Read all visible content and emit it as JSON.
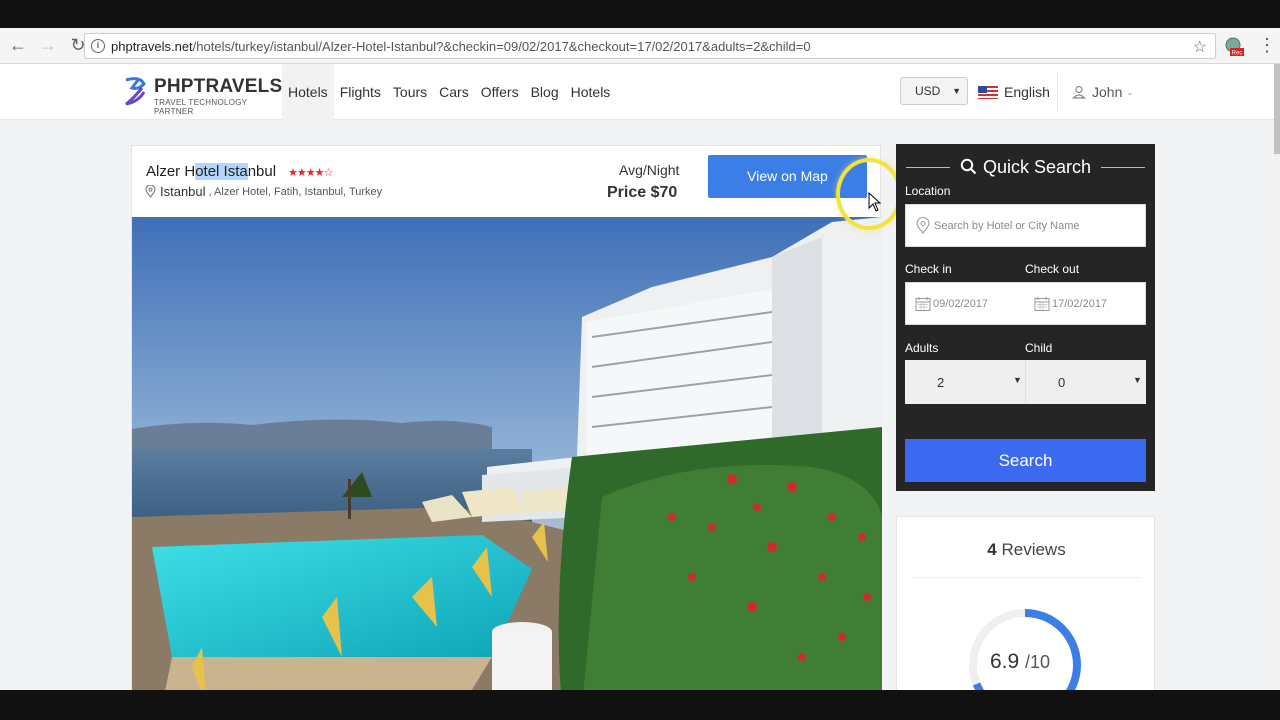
{
  "browser": {
    "url_domain": "phptravels.net",
    "url_path": "/hotels/turkey/istanbul/Alzer-Hotel-Istanbul?&checkin=09/02/2017&checkout=17/02/2017&adults=2&child=0"
  },
  "header": {
    "logo_brand": "PHPTRAVELS",
    "logo_tagline": "TRAVEL TECHNOLOGY PARTNER",
    "nav": [
      "Hotels",
      "Flights",
      "Tours",
      "Cars",
      "Offers",
      "Blog",
      "Hotels"
    ],
    "currency": "USD",
    "language": "English",
    "user": "John"
  },
  "hotel": {
    "title_a": "Alzer H",
    "title_hl": "otel Ista",
    "title_b": "nbul",
    "rating_stars": 4,
    "city": "Istanbul",
    "address": ", Alzer Hotel, Fatih, Istanbul, Turkey",
    "avg_label": "Avg/Night",
    "price": "Price $70",
    "map_button": "View on Map"
  },
  "quick_search": {
    "title": "Quick Search",
    "location_label": "Location",
    "location_placeholder": "Search by Hotel or City Name",
    "checkin_label": "Check in",
    "checkout_label": "Check out",
    "checkin": "09/02/2017",
    "checkout": "17/02/2017",
    "adults_label": "Adults",
    "child_label": "Child",
    "adults": "2",
    "child": "0",
    "search_button": "Search"
  },
  "reviews": {
    "count": "4",
    "label": "Reviews",
    "score": "6.9",
    "out_of": "/10",
    "score_fraction": 0.69
  },
  "colors": {
    "accent_blue": "#3b7fe6",
    "search_blue": "#3b69f0",
    "panel_dark": "#252525",
    "star_red": "#e22233"
  }
}
